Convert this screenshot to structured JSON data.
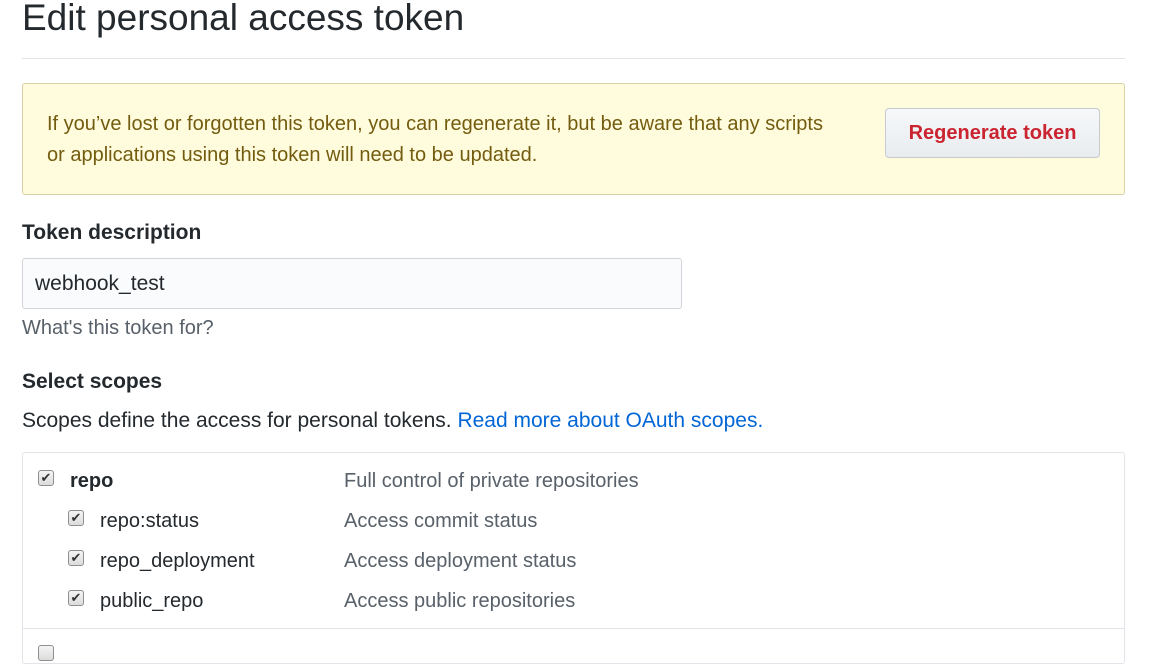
{
  "page_title": "Edit personal access token",
  "flash": {
    "message": "If you’ve lost or forgotten this token, you can regenerate it, but be aware that any scripts or applications using this token will need to be updated.",
    "regenerate_label": "Regenerate token"
  },
  "description": {
    "label": "Token description",
    "value": "webhook_test",
    "hint": "What's this token for?"
  },
  "scopes": {
    "label": "Select scopes",
    "intro": "Scopes define the access for personal tokens.",
    "link_text": "Read more about OAuth scopes.",
    "items": [
      {
        "name": "repo",
        "description": "Full control of private repositories",
        "checked": true,
        "level": 0
      },
      {
        "name": "repo:status",
        "description": "Access commit status",
        "checked": true,
        "level": 1
      },
      {
        "name": "repo_deployment",
        "description": "Access deployment status",
        "checked": true,
        "level": 1
      },
      {
        "name": "public_repo",
        "description": "Access public repositories",
        "checked": true,
        "level": 1
      }
    ],
    "next_group": {
      "checked": false
    }
  },
  "colors": {
    "flash_text": "#735c0f",
    "flash_bg": "#fffbdd",
    "danger": "#cb2431",
    "link": "#0366d6",
    "muted": "#586069"
  },
  "icons": {
    "checkmark": "checkmark-icon"
  }
}
